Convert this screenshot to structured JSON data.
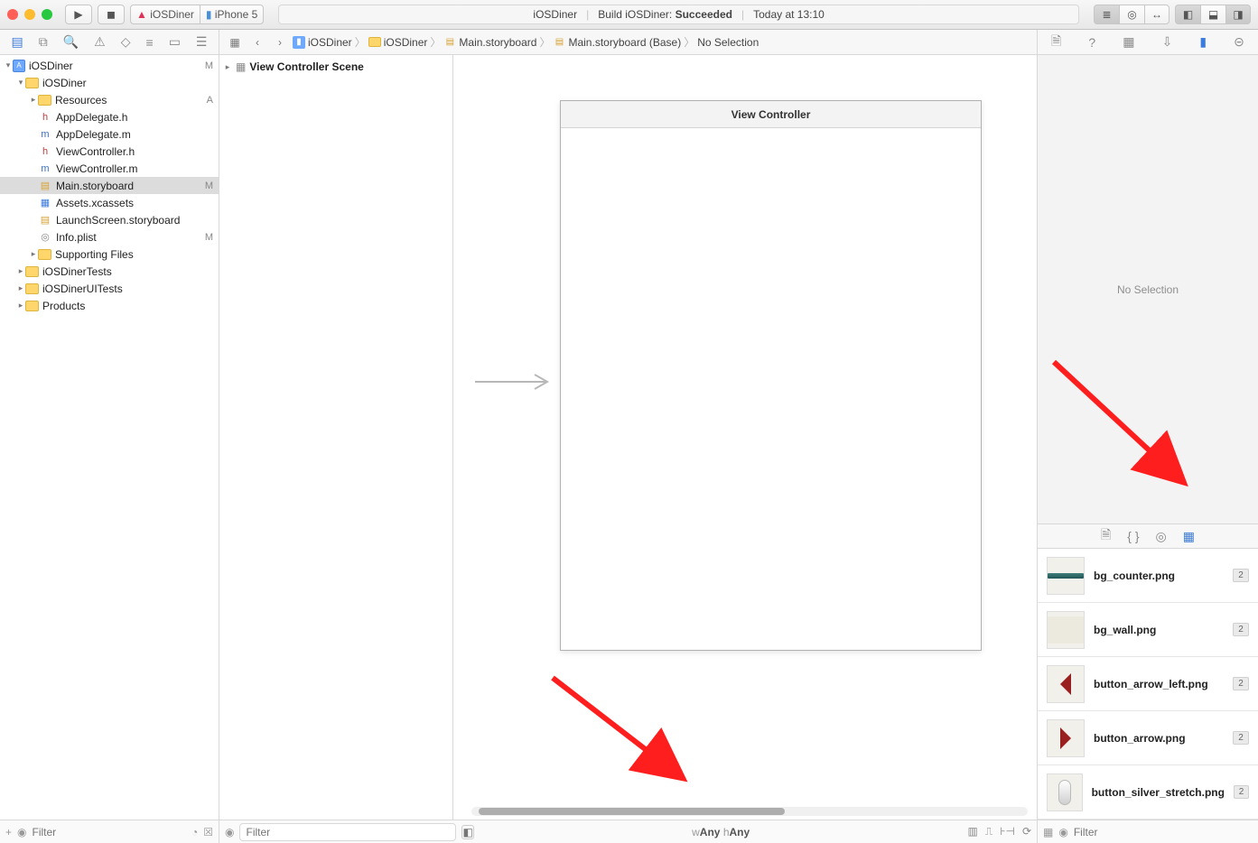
{
  "toolbar": {
    "scheme_project": "iOSDiner",
    "scheme_device": "iPhone 5",
    "status_project": "iOSDiner",
    "status_build_prefix": "Build iOSDiner:",
    "status_build_result": "Succeeded",
    "status_time": "Today at 13:10"
  },
  "navigator": {
    "filter_placeholder": "Filter",
    "tree": [
      {
        "indent": 0,
        "icon": "proj",
        "label": "iOSDiner",
        "badge": "M",
        "disclose": "▾"
      },
      {
        "indent": 1,
        "icon": "folder",
        "label": "iOSDiner",
        "badge": "",
        "disclose": "▾"
      },
      {
        "indent": 2,
        "icon": "folder",
        "label": "Resources",
        "badge": "A",
        "disclose": "▸"
      },
      {
        "indent": 2,
        "icon": "h",
        "label": "AppDelegate.h",
        "badge": "",
        "disclose": ""
      },
      {
        "indent": 2,
        "icon": "m",
        "label": "AppDelegate.m",
        "badge": "",
        "disclose": ""
      },
      {
        "indent": 2,
        "icon": "h",
        "label": "ViewController.h",
        "badge": "",
        "disclose": ""
      },
      {
        "indent": 2,
        "icon": "m",
        "label": "ViewController.m",
        "badge": "",
        "disclose": ""
      },
      {
        "indent": 2,
        "icon": "sb",
        "label": "Main.storyboard",
        "badge": "M",
        "disclose": "",
        "selected": true
      },
      {
        "indent": 2,
        "icon": "assets",
        "label": "Assets.xcassets",
        "badge": "",
        "disclose": ""
      },
      {
        "indent": 2,
        "icon": "sb",
        "label": "LaunchScreen.storyboard",
        "badge": "",
        "disclose": ""
      },
      {
        "indent": 2,
        "icon": "plist",
        "label": "Info.plist",
        "badge": "M",
        "disclose": ""
      },
      {
        "indent": 2,
        "icon": "folder",
        "label": "Supporting Files",
        "badge": "",
        "disclose": "▸"
      },
      {
        "indent": 1,
        "icon": "folder",
        "label": "iOSDinerTests",
        "badge": "",
        "disclose": "▸"
      },
      {
        "indent": 1,
        "icon": "folder",
        "label": "iOSDinerUITests",
        "badge": "",
        "disclose": "▸"
      },
      {
        "indent": 1,
        "icon": "folder",
        "label": "Products",
        "badge": "",
        "disclose": "▸"
      }
    ]
  },
  "jumpbar": {
    "crumbs": [
      {
        "icon": "blue",
        "label": "iOSDiner"
      },
      {
        "icon": "folder",
        "label": "iOSDiner"
      },
      {
        "icon": "sb",
        "label": "Main.storyboard"
      },
      {
        "icon": "sb",
        "label": "Main.storyboard (Base)"
      },
      {
        "icon": "",
        "label": "No Selection"
      }
    ]
  },
  "outline": {
    "scene": "View Controller Scene"
  },
  "canvas": {
    "vc_title": "View Controller"
  },
  "sizeclass": {
    "w_prefix": "w",
    "w": "Any",
    "h_prefix": "h",
    "h": "Any"
  },
  "inspector": {
    "empty": "No Selection",
    "filter_placeholder": "Filter"
  },
  "library": {
    "items": [
      {
        "name": "bg_counter.png",
        "count": "2",
        "thumb": "counter"
      },
      {
        "name": "bg_wall.png",
        "count": "2",
        "thumb": "wall"
      },
      {
        "name": "button_arrow_left.png",
        "count": "2",
        "thumb": "arrowL"
      },
      {
        "name": "button_arrow.png",
        "count": "2",
        "thumb": "arrowR"
      },
      {
        "name": "button_silver_stretch.png",
        "count": "2",
        "thumb": "silver"
      }
    ]
  },
  "editor_filter_placeholder": "Filter"
}
